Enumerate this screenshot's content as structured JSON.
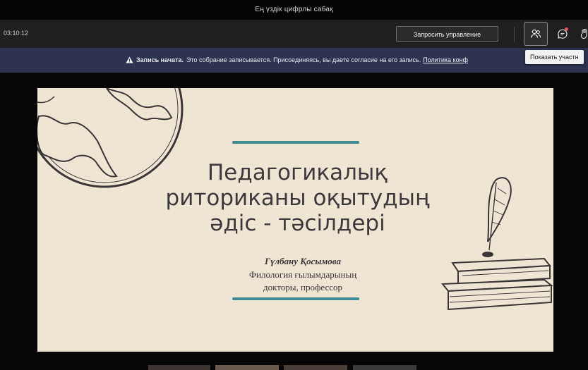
{
  "window": {
    "title": "Ең үздік цифрлы сабақ"
  },
  "toolbar": {
    "timer": "03:10:12",
    "request_control_label": "Запросить управление",
    "people_icon": "people-icon",
    "chat_icon": "chat-icon",
    "tooltip": "Показать участн"
  },
  "banner": {
    "icon": "warning-icon",
    "strong": "Запись начата.",
    "text": "Это собрание записывается. Присоединяясь, вы даете согласие на его запись.",
    "link": "Политика конф"
  },
  "slide": {
    "title_lines": [
      "Педагогикалық",
      "риториканы оқытудың",
      "әдіс - тәсілдері"
    ],
    "author": "Гүлбану Қосымова",
    "degree_lines": [
      "Филология ғылымдарының",
      "докторы, профессор"
    ]
  },
  "colors": {
    "banner": "#2e3350",
    "accent_line": "#3f8a90",
    "slide_bg": "#efe5d5",
    "notification_dot": "#e0535b"
  }
}
